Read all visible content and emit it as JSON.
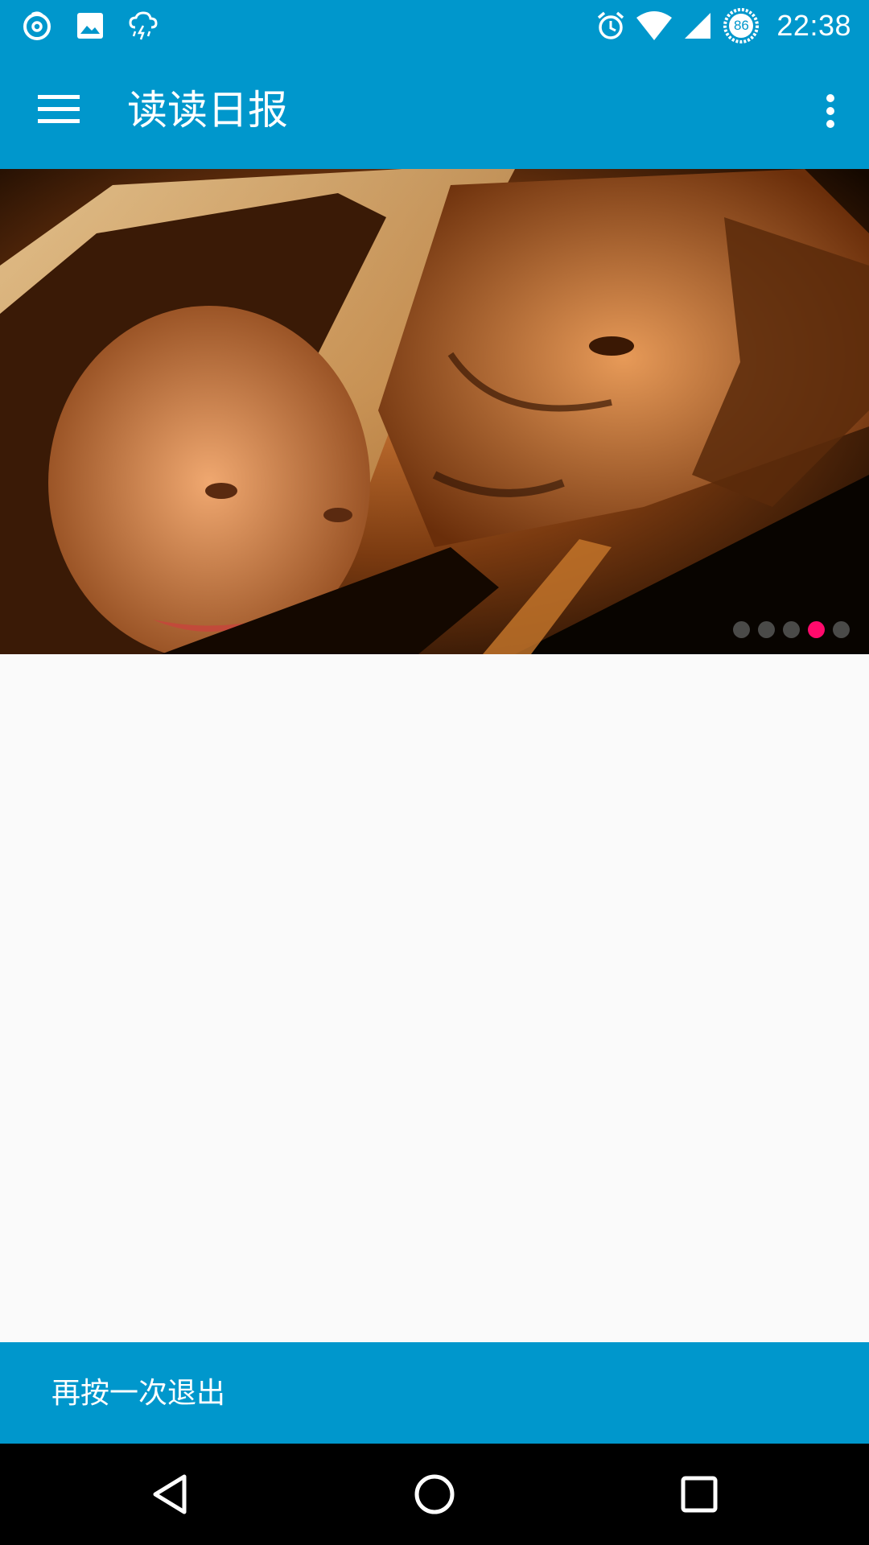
{
  "status_bar": {
    "left_icons": [
      "netease-music-icon",
      "image-icon",
      "weather-storm-icon"
    ],
    "right_icons": [
      "alarm-icon",
      "wifi-icon",
      "cell-signal-icon",
      "battery-icon"
    ],
    "battery_level": "86",
    "time": "22:38"
  },
  "app_bar": {
    "title": "读读日报",
    "menu_icon": "hamburger-menu-icon",
    "overflow_icon": "more-vert-icon"
  },
  "banner": {
    "page_count": 5,
    "active_index": 3,
    "active_color": "#ff0a6c",
    "inactive_color": "#4a4a48"
  },
  "snackbar": {
    "message": "再按一次退出"
  },
  "colors": {
    "primary": "#0097cc",
    "background": "#fafafa",
    "nav_bar": "#000000"
  },
  "nav_bar": {
    "buttons": [
      "back-icon",
      "home-icon",
      "recents-icon"
    ]
  }
}
